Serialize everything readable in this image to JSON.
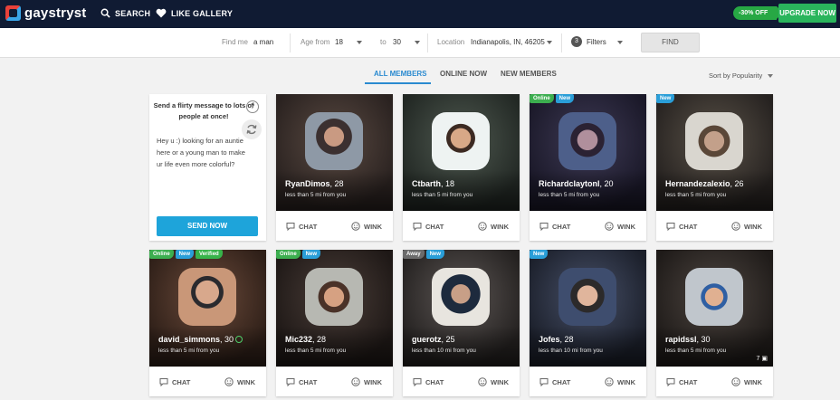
{
  "header": {
    "logo_text": "gaystryst",
    "nav": [
      {
        "label": "SEARCH",
        "icon": "search-icon"
      },
      {
        "label": "LIKE GALLERY",
        "icon": "heart-icon"
      }
    ],
    "promo_label": "-30% OFF",
    "upgrade_label": "UPGRADE NOW"
  },
  "filters": {
    "find_me_label": "Find me",
    "find_me_value": "a man",
    "age_from_label": "Age from",
    "age_from_value": "18",
    "age_to_label": "to",
    "age_to_value": "30",
    "location_label": "Location",
    "location_value": "Indianapolis, IN, 46205",
    "filters_count": "3",
    "filters_label": "Filters",
    "find_button": "FIND"
  },
  "tabs": [
    {
      "label": "ALL MEMBERS",
      "active": true
    },
    {
      "label": "ONLINE NOW",
      "active": false
    },
    {
      "label": "NEW MEMBERS",
      "active": false
    }
  ],
  "sort_label": "Sort by Popularity",
  "message_card": {
    "title": "Send a flirty message to lots of people at once!",
    "help": "?",
    "message": "Hey u :) looking for an auntie here or a young man to make ur life even more colorful?",
    "send_button": "SEND NOW"
  },
  "actions": {
    "chat": "CHAT",
    "wink": "WINK"
  },
  "profiles": [
    {
      "name": "RyanDimos",
      "age": ", 28",
      "distance": "less than 5 mi from you",
      "badges": []
    },
    {
      "name": "Ctbarth",
      "age": ", 18",
      "distance": "less than 5 mi from you",
      "badges": []
    },
    {
      "name": "Richardclaytonl",
      "age": ", 20",
      "distance": "less than 5 mi from you",
      "badges": [
        "Online",
        "New"
      ]
    },
    {
      "name": "Hernandezalexio",
      "age": ", 26",
      "distance": "less than 5 mi from you",
      "badges": [
        "New"
      ]
    },
    {
      "name": "david_simmons",
      "age": ", 30",
      "distance": "less than 5 mi from you",
      "badges": [
        "Online",
        "New",
        "Verified"
      ]
    },
    {
      "name": "Mic232",
      "age": ", 28",
      "distance": "less than 5 mi from you",
      "badges": [
        "Online",
        "New"
      ]
    },
    {
      "name": "guerotz",
      "age": ", 25",
      "distance": "less than 10 mi from you",
      "badges": [
        "Away",
        "New"
      ]
    },
    {
      "name": "Jofes",
      "age": ", 28",
      "distance": "less than 10 mi from you",
      "badges": [
        "New"
      ]
    },
    {
      "name": "rapidssl",
      "age": ", 30",
      "distance": "less than 5 mi from you",
      "badges": [],
      "photo_count": "7"
    }
  ],
  "colors": {
    "topbar": "#101b33",
    "accent_blue": "#1ea4da",
    "upgrade_green": "#2ab55c",
    "badge_new": "#2a9ed8",
    "badge_online": "#3cae4f"
  }
}
